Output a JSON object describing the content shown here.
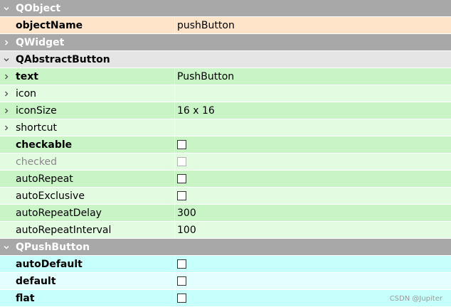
{
  "colors": {
    "category_bg": "#a8a8a8",
    "qobject_row": "#fee5ca",
    "qabstractbutton_row_a": "#c9f5c6",
    "qabstractbutton_row_b": "#e3fbe0",
    "qpushbutton_row_a": "#c6fffc",
    "qpushbutton_row_b": "#e2fffe"
  },
  "groups": [
    {
      "label": "QObject",
      "expanded": true,
      "rows": [
        {
          "name": "objectName",
          "value": "pushButton",
          "bold": true,
          "expandable": false,
          "type": "text"
        }
      ]
    },
    {
      "label": "QWidget",
      "expanded": false,
      "rows": []
    },
    {
      "label": "QAbstractButton",
      "expanded": true,
      "rows": [
        {
          "name": "text",
          "value": "PushButton",
          "bold": true,
          "expandable": true,
          "type": "text"
        },
        {
          "name": "icon",
          "value": "",
          "bold": false,
          "expandable": true,
          "type": "text"
        },
        {
          "name": "iconSize",
          "value": "16 x 16",
          "bold": false,
          "expandable": true,
          "type": "text"
        },
        {
          "name": "shortcut",
          "value": "",
          "bold": false,
          "expandable": true,
          "type": "text"
        },
        {
          "name": "checkable",
          "checked": false,
          "bold": true,
          "expandable": false,
          "type": "checkbox"
        },
        {
          "name": "checked",
          "checked": false,
          "bold": false,
          "expandable": false,
          "type": "checkbox",
          "disabled": true
        },
        {
          "name": "autoRepeat",
          "checked": false,
          "bold": false,
          "expandable": false,
          "type": "checkbox"
        },
        {
          "name": "autoExclusive",
          "checked": false,
          "bold": false,
          "expandable": false,
          "type": "checkbox"
        },
        {
          "name": "autoRepeatDelay",
          "value": "300",
          "bold": false,
          "expandable": false,
          "type": "text"
        },
        {
          "name": "autoRepeatInterval",
          "value": "100",
          "bold": false,
          "expandable": false,
          "type": "text"
        }
      ]
    },
    {
      "label": "QPushButton",
      "expanded": true,
      "rows": [
        {
          "name": "autoDefault",
          "checked": false,
          "bold": true,
          "expandable": false,
          "type": "checkbox"
        },
        {
          "name": "default",
          "checked": false,
          "bold": true,
          "expandable": false,
          "type": "checkbox"
        },
        {
          "name": "flat",
          "checked": false,
          "bold": true,
          "expandable": false,
          "type": "checkbox"
        }
      ]
    }
  ],
  "watermark": "CSDN @Jupiter"
}
